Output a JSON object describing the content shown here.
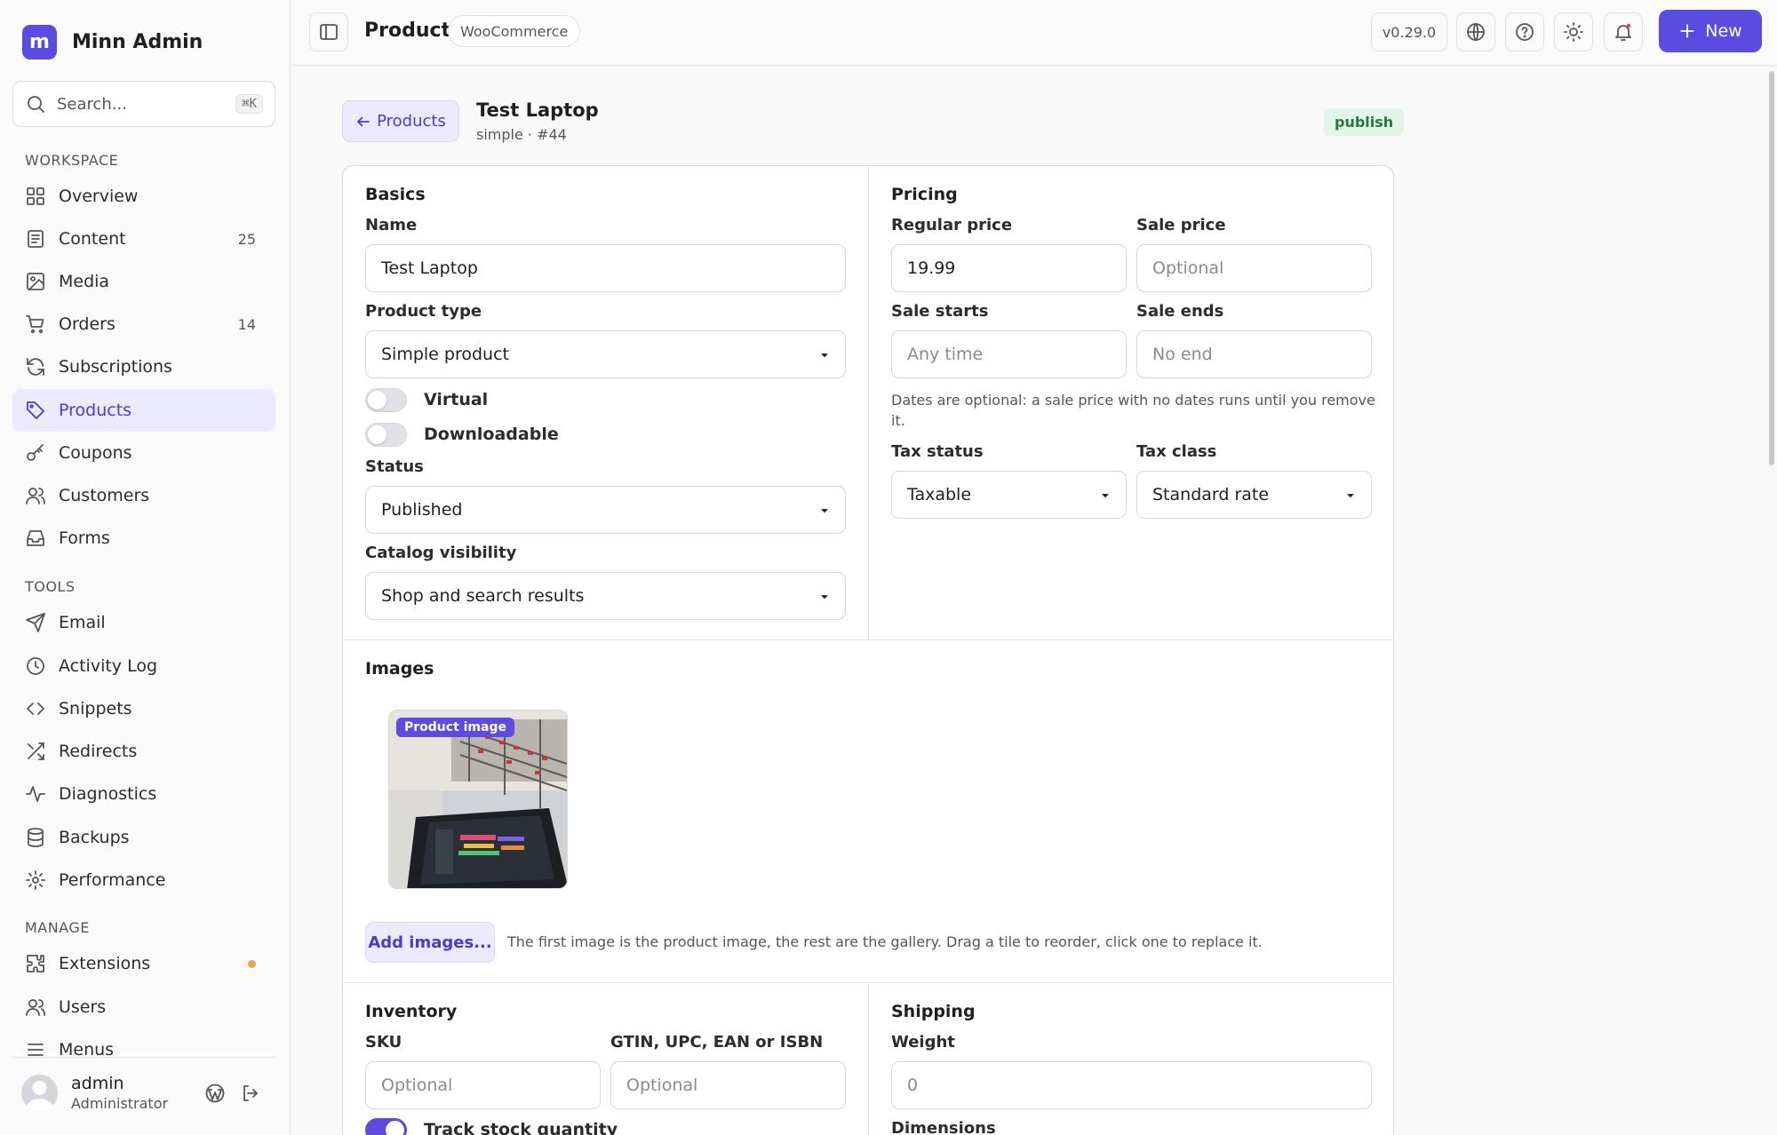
{
  "brand": {
    "logo_letter": "m",
    "name": "Minn Admin"
  },
  "search": {
    "placeholder": "Search...",
    "shortcut": "⌘K"
  },
  "sidebar": {
    "workspace_label": "WORKSPACE",
    "tools_label": "TOOLS",
    "manage_label": "MANAGE",
    "workspace": [
      {
        "label": "Overview",
        "icon": "grid-icon"
      },
      {
        "label": "Content",
        "icon": "document-icon",
        "count": "25"
      },
      {
        "label": "Media",
        "icon": "image-icon"
      },
      {
        "label": "Orders",
        "icon": "cart-icon",
        "count": "14"
      },
      {
        "label": "Subscriptions",
        "icon": "refresh-icon"
      },
      {
        "label": "Products",
        "icon": "tag-icon",
        "active": true
      },
      {
        "label": "Coupons",
        "icon": "key-icon"
      },
      {
        "label": "Customers",
        "icon": "users-icon"
      },
      {
        "label": "Forms",
        "icon": "inbox-icon"
      }
    ],
    "tools": [
      {
        "label": "Email",
        "icon": "send-icon"
      },
      {
        "label": "Activity Log",
        "icon": "clock-icon"
      },
      {
        "label": "Snippets",
        "icon": "code-icon"
      },
      {
        "label": "Redirects",
        "icon": "shuffle-icon"
      },
      {
        "label": "Diagnostics",
        "icon": "activity-icon"
      },
      {
        "label": "Backups",
        "icon": "database-icon"
      },
      {
        "label": "Performance",
        "icon": "gear-icon"
      }
    ],
    "manage": [
      {
        "label": "Extensions",
        "icon": "puzzle-icon",
        "dot_color": "#e8a84a"
      },
      {
        "label": "Users",
        "icon": "users-icon"
      },
      {
        "label": "Menus",
        "icon": "menu-icon"
      }
    ],
    "user": {
      "name": "admin",
      "role": "Administrator"
    }
  },
  "topbar": {
    "title": "Product",
    "tag": "WooCommerce",
    "version": "v0.29.0",
    "new_label": "New"
  },
  "product": {
    "back_label": "Products",
    "title": "Test Laptop",
    "subtitle": "simple · #44",
    "status_badge": "publish"
  },
  "basics": {
    "heading": "Basics",
    "name_label": "Name",
    "name_value": "Test Laptop",
    "type_label": "Product type",
    "type_value": "Simple product",
    "virtual_label": "Virtual",
    "virtual_on": false,
    "downloadable_label": "Downloadable",
    "downloadable_on": false,
    "status_label": "Status",
    "status_value": "Published",
    "visibility_label": "Catalog visibility",
    "visibility_value": "Shop and search results"
  },
  "pricing": {
    "heading": "Pricing",
    "regular_label": "Regular price",
    "regular_value": "19.99",
    "sale_label": "Sale price",
    "sale_placeholder": "Optional",
    "starts_label": "Sale starts",
    "starts_placeholder": "Any time",
    "ends_label": "Sale ends",
    "ends_placeholder": "No end",
    "dates_help": "Dates are optional: a sale price with no dates runs until you remove it.",
    "tax_status_label": "Tax status",
    "tax_status_value": "Taxable",
    "tax_class_label": "Tax class",
    "tax_class_value": "Standard rate"
  },
  "images": {
    "heading": "Images",
    "badge": "Product image",
    "add_label": "Add images...",
    "help": "The first image is the product image, the rest are the gallery. Drag a tile to reorder, click one to replace it."
  },
  "inventory": {
    "heading": "Inventory",
    "sku_label": "SKU",
    "sku_placeholder": "Optional",
    "gtin_label": "GTIN, UPC, EAN or ISBN",
    "gtin_placeholder": "Optional",
    "track_label": "Track stock quantity",
    "track_on": true
  },
  "shipping": {
    "heading": "Shipping",
    "weight_label": "Weight",
    "weight_placeholder": "0",
    "dimensions_label": "Dimensions"
  }
}
